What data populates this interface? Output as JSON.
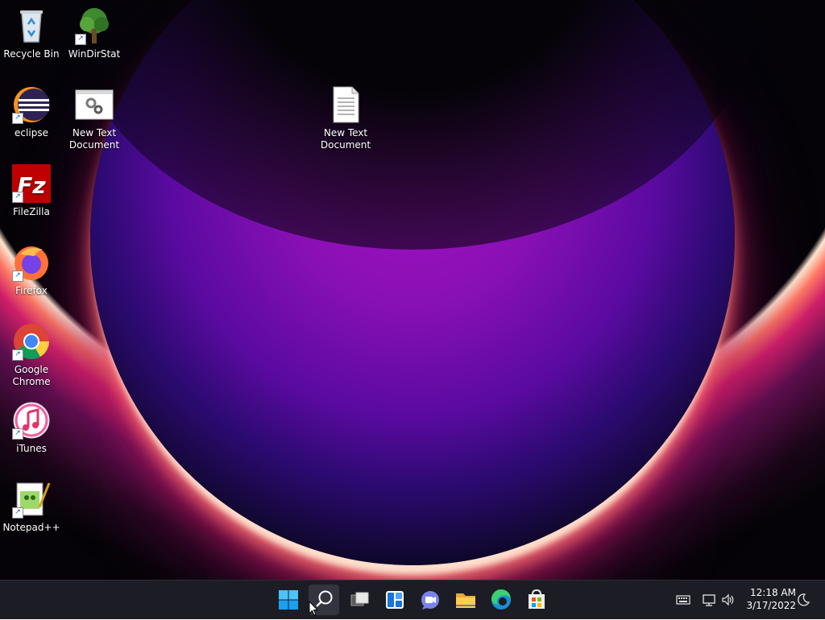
{
  "desktop": {
    "icons": [
      {
        "label": "Recycle Bin",
        "icon": "recycle-bin-icon"
      },
      {
        "label": "WinDirStat",
        "icon": "windirstat-icon"
      },
      {
        "label": "eclipse",
        "icon": "eclipse-icon"
      },
      {
        "label": "New Text Document",
        "icon": "settings-document-icon"
      },
      {
        "label": "New Text Document",
        "icon": "text-document-icon"
      },
      {
        "label": "FileZilla",
        "icon": "filezilla-icon"
      },
      {
        "label": "Firefox",
        "icon": "firefox-icon"
      },
      {
        "label": "Google Chrome",
        "icon": "chrome-icon"
      },
      {
        "label": "iTunes",
        "icon": "itunes-icon"
      },
      {
        "label": "Notepad++",
        "icon": "notepadpp-icon"
      }
    ]
  },
  "taskbar": {
    "buttons": [
      {
        "name": "start",
        "icon": "windows-logo-icon"
      },
      {
        "name": "search",
        "icon": "search-icon"
      },
      {
        "name": "task-view",
        "icon": "task-view-icon"
      },
      {
        "name": "widgets",
        "icon": "widgets-icon"
      },
      {
        "name": "chat",
        "icon": "teams-chat-icon"
      },
      {
        "name": "file-explorer",
        "icon": "folder-icon"
      },
      {
        "name": "edge",
        "icon": "edge-icon"
      },
      {
        "name": "store",
        "icon": "store-icon"
      }
    ],
    "tray": {
      "time": "12:18 AM",
      "date": "3/17/2022",
      "icons": [
        "keyboard-icon",
        "network-icon",
        "volume-icon",
        "focus-assist-icon"
      ]
    }
  },
  "colors": {
    "taskbar_bg": "#1c1c24",
    "accent_blue": "#0078d4"
  }
}
